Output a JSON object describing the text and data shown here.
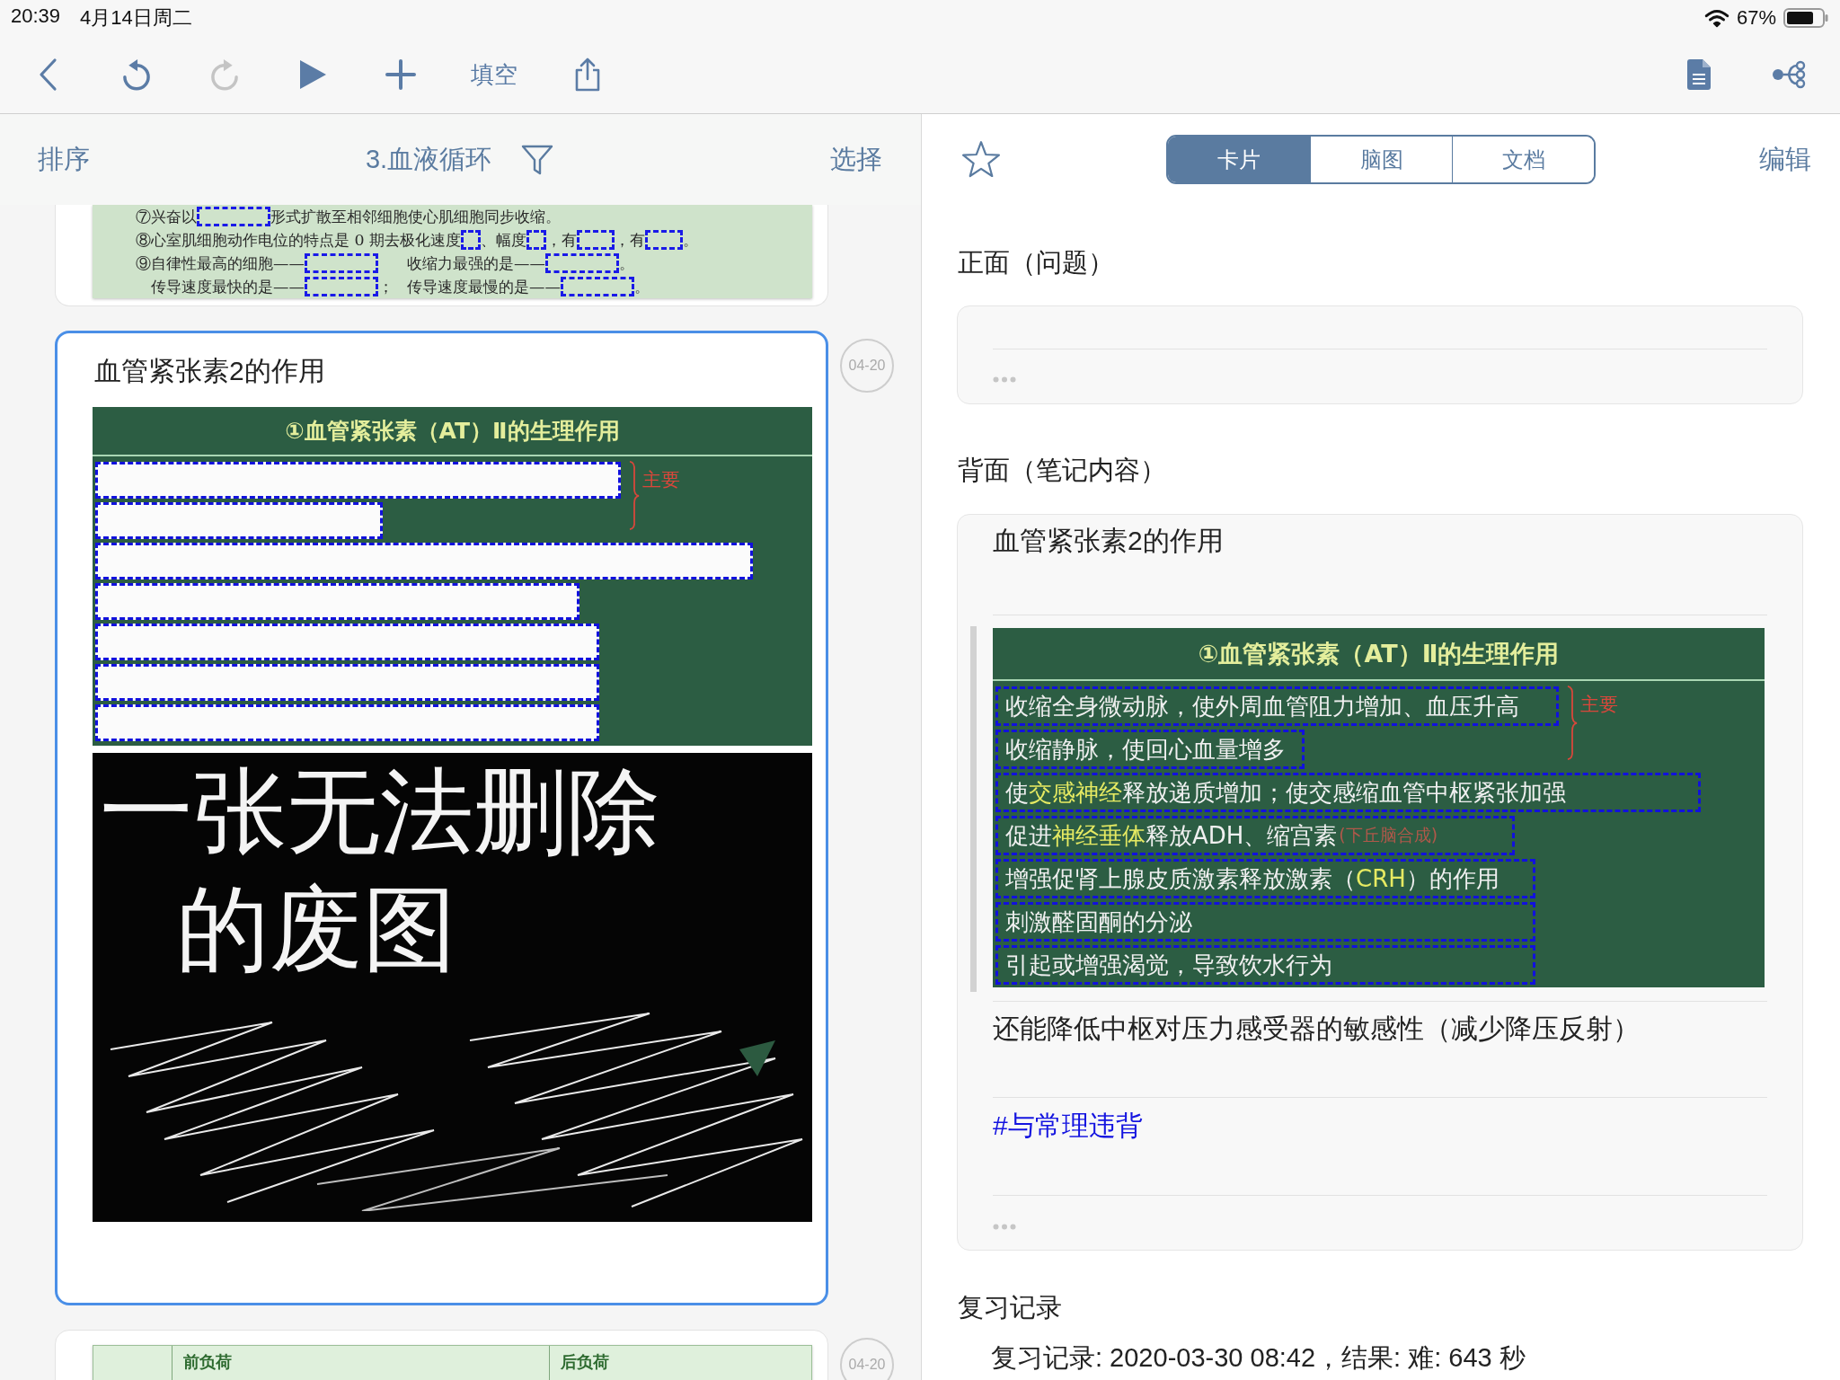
{
  "status_bar": {
    "time": "20:39",
    "date": "4月14日周二",
    "battery": "67%"
  },
  "toolbar": {
    "left": [
      {
        "kind": "back",
        "disabled": false
      },
      {
        "kind": "undo",
        "disabled": false
      },
      {
        "kind": "redo",
        "disabled": true
      },
      {
        "kind": "play",
        "disabled": false
      },
      {
        "kind": "add",
        "disabled": false
      },
      {
        "kind": "label",
        "label": "填空",
        "disabled": false
      },
      {
        "kind": "share",
        "disabled": false
      }
    ],
    "right": [
      {
        "kind": "document",
        "disabled": false
      },
      {
        "kind": "mindmap",
        "disabled": false
      }
    ]
  },
  "list_header": {
    "sort": "排序",
    "title": "3.血液循环",
    "select": "选择"
  },
  "cards": [
    {
      "kind": "scan",
      "selected": false,
      "lines": [
        {
          "indent": false,
          "columns": [
            [
              {
                "kind": "text",
                "text": "⑦兴奋以"
              },
              {
                "kind": "blank"
              },
              {
                "kind": "text",
                "text": "形式扩散至相邻细胞使心肌细胞同步收缩。"
              }
            ]
          ]
        },
        {
          "indent": false,
          "columns": [
            [
              {
                "kind": "text",
                "text": "⑧心室肌细胞动作电位的特点是 0 期去极化速度"
              },
              {
                "kind": "blank_small"
              },
              {
                "kind": "text",
                "text": "、幅度"
              },
              {
                "kind": "blank_small"
              },
              {
                "kind": "text",
                "text": "，有"
              },
              {
                "kind": "blank_medium"
              },
              {
                "kind": "text",
                "text": "，有"
              },
              {
                "kind": "blank_medium"
              },
              {
                "kind": "text",
                "text": "。"
              }
            ]
          ]
        },
        {
          "indent": false,
          "columns": [
            [
              {
                "kind": "text",
                "text": "⑨自律性最高的细胞——"
              },
              {
                "kind": "blank"
              }
            ],
            [
              {
                "kind": "text",
                "text": "收缩力最强的是——"
              },
              {
                "kind": "blank"
              },
              {
                "kind": "text",
                "text": "。"
              }
            ]
          ]
        },
        {
          "indent": true,
          "columns": [
            [
              {
                "kind": "text",
                "text": "传导速度最快的是——"
              },
              {
                "kind": "blank"
              },
              {
                "kind": "text",
                "text": "；"
              }
            ],
            [
              {
                "kind": "text",
                "text": "传导速度最慢的是——"
              },
              {
                "kind": "blank"
              },
              {
                "kind": "text",
                "text": "。"
              }
            ]
          ]
        }
      ]
    },
    {
      "kind": "note",
      "selected": true,
      "title": "血管紧张素2的作用",
      "date": "04-20",
      "slide": {
        "title": "①血管紧张素（AT）Ⅱ的生理作用",
        "lines": [
          {
            "revealed": false,
            "note": {
              "kind": "brace",
              "text": "主要"
            }
          },
          {
            "revealed": false
          },
          {
            "revealed": false
          },
          {
            "revealed": false
          },
          {
            "revealed": false
          },
          {
            "revealed": false
          },
          {
            "revealed": false
          }
        ]
      },
      "drawing_text": "一张无法删除的废图"
    },
    {
      "kind": "table",
      "selected": false,
      "date": "04-20",
      "columns": [
        "前负荷",
        "后负荷"
      ]
    }
  ],
  "detail": {
    "favorite": false,
    "tabs": [
      {
        "label": "卡片",
        "selected": true
      },
      {
        "label": "脑图",
        "selected": false
      },
      {
        "label": "文档",
        "selected": false
      }
    ],
    "edit": "编辑",
    "front": {
      "heading": "正面（问题）"
    },
    "back": {
      "heading": "背面（笔记内容）",
      "title": "血管紧张素2的作用",
      "slide": {
        "title": "①血管紧张素（AT）Ⅱ的生理作用",
        "lines": [
          {
            "revealed": true,
            "segments": [
              {
                "text": "收缩全身微动脉，使外周血管阻力增加、血压升高",
                "highlight": false
              }
            ],
            "note": {
              "kind": "brace",
              "text": "主要"
            }
          },
          {
            "revealed": true,
            "segments": [
              {
                "text": "收缩静脉，使回心血量增多",
                "highlight": false
              }
            ]
          },
          {
            "revealed": true,
            "segments": [
              {
                "text": "使",
                "highlight": false
              },
              {
                "text": "交感神经",
                "highlight": true
              },
              {
                "text": "释放递质增加；使交感缩血管中枢紧张加强",
                "highlight": false
              }
            ]
          },
          {
            "revealed": true,
            "segments": [
              {
                "text": "促进",
                "highlight": false
              },
              {
                "text": "神经垂体",
                "highlight": true
              },
              {
                "text": "释放ADH、缩宫素",
                "highlight": false
              }
            ],
            "note": {
              "kind": "inline",
              "text": "(下丘脑合成)"
            }
          },
          {
            "revealed": true,
            "segments": [
              {
                "text": "增强促肾上腺皮质激素释放激素（",
                "highlight": false
              },
              {
                "text": "CRH",
                "highlight": true
              },
              {
                "text": "）的作用",
                "highlight": false
              }
            ]
          },
          {
            "revealed": true,
            "segments": [
              {
                "text": "刺激醛固酮的分泌",
                "highlight": false
              }
            ]
          },
          {
            "revealed": true,
            "segments": [
              {
                "text": "引起或增强渴觉，导致饮水行为",
                "highlight": false
              }
            ]
          }
        ]
      },
      "text": "还能降低中枢对压力感受器的敏感性（减少降压反射）",
      "tag": "#与常理违背"
    },
    "review": {
      "heading": "复习记录",
      "entries": [
        "复习记录: 2020-03-30 08:42，结果: 难: 643 秒"
      ]
    }
  }
}
